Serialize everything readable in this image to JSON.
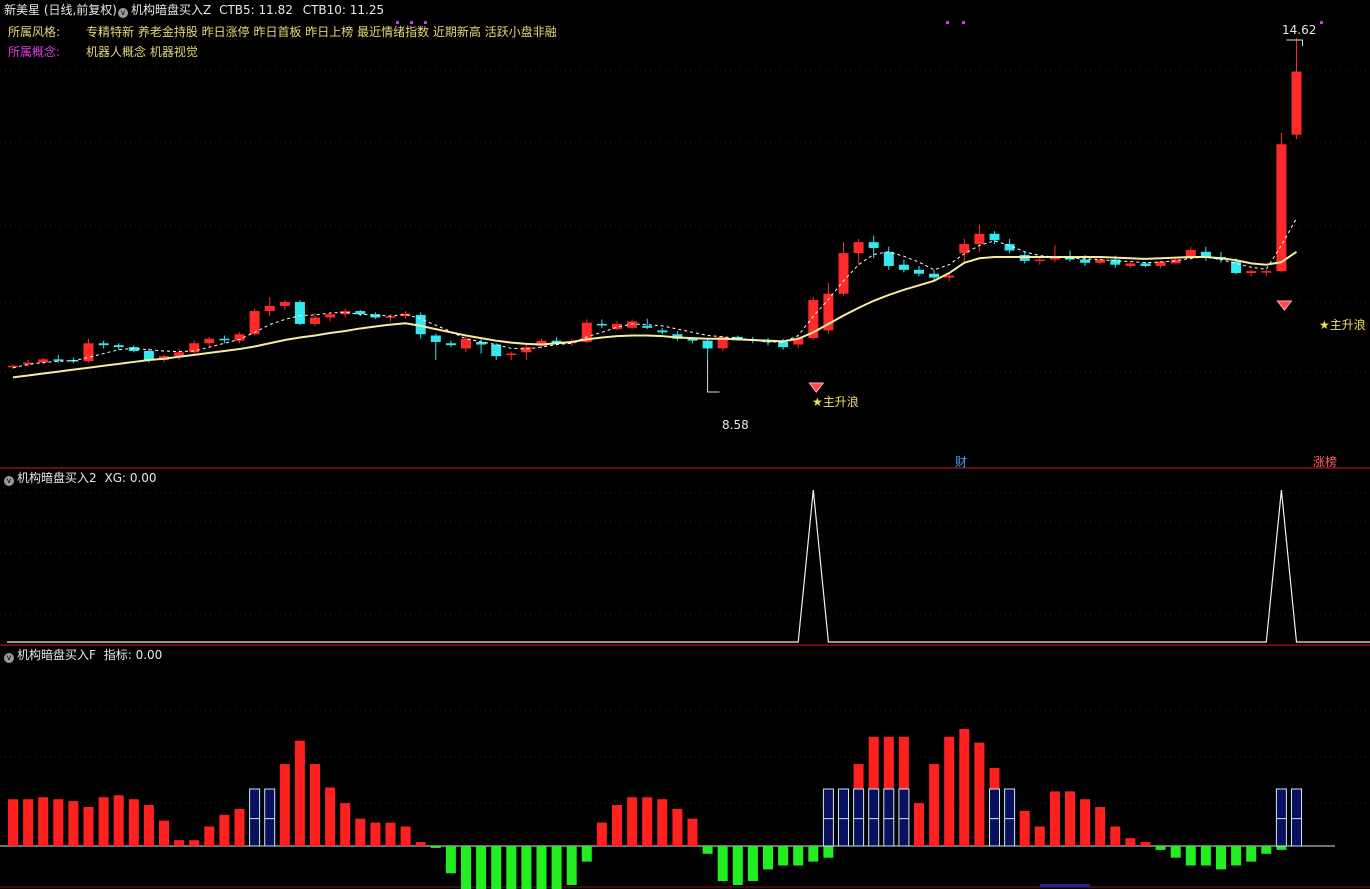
{
  "header": {
    "stock_title": "新美星 (日线,前复权)",
    "indicator_name": "机构暗盘买入Z",
    "ctb5": "CTB5: 11.82",
    "ctb10": "CTB10: 11.25",
    "style_label": "所属风格:",
    "style_tags": "专精特新 养老金持股 昨日涨停 昨日首板 昨日上榜 最近情绪指数 近期新高 活跃小盘非融",
    "concept_label": "所属概念:",
    "concept_tags": "机器人概念 机器视觉"
  },
  "main_chart": {
    "high_label": "14.62",
    "low_label": "8.58",
    "signal_labels": [
      "★主升浪",
      "★主升浪"
    ],
    "event_badges": [
      "财",
      "涨榜"
    ]
  },
  "panel2": {
    "title": "机构暗盘买入2",
    "value": "XG: 0.00"
  },
  "panel3": {
    "title": "机构暗盘买入F",
    "value": "指标: 0.00"
  },
  "colors": {
    "up": "#ff2a2a",
    "down": "#35e8ef",
    "ma_fast": "#ffffff",
    "ma_slow": "#f5eca0",
    "hist_up": "#ff2020",
    "hist_down": "#22ee22",
    "divider": "#8b1010"
  },
  "chart_data": [
    {
      "type": "candlestick",
      "title": "新美星 (日线,前复权)",
      "ohlc": [
        [
          9.52,
          9.55,
          9.48,
          9.53
        ],
        [
          9.55,
          9.62,
          9.52,
          9.58
        ],
        [
          9.58,
          9.65,
          9.55,
          9.63
        ],
        [
          9.63,
          9.7,
          9.58,
          9.61
        ],
        [
          9.62,
          9.66,
          9.57,
          9.6
        ],
        [
          9.6,
          9.95,
          9.58,
          9.88
        ],
        [
          9.88,
          9.92,
          9.8,
          9.85
        ],
        [
          9.85,
          9.88,
          9.78,
          9.82
        ],
        [
          9.82,
          9.85,
          9.74,
          9.76
        ],
        [
          9.76,
          9.8,
          9.58,
          9.62
        ],
        [
          9.62,
          9.7,
          9.58,
          9.68
        ],
        [
          9.68,
          9.8,
          9.62,
          9.74
        ],
        [
          9.74,
          9.92,
          9.7,
          9.88
        ],
        [
          9.88,
          9.98,
          9.83,
          9.95
        ],
        [
          9.95,
          10.0,
          9.88,
          9.93
        ],
        [
          9.92,
          10.05,
          9.88,
          10.02
        ],
        [
          10.02,
          10.42,
          10.0,
          10.38
        ],
        [
          10.38,
          10.6,
          10.3,
          10.46
        ],
        [
          10.46,
          10.55,
          10.4,
          10.52
        ],
        [
          10.52,
          10.55,
          10.16,
          10.18
        ],
        [
          10.18,
          10.35,
          10.15,
          10.28
        ],
        [
          10.28,
          10.36,
          10.22,
          10.33
        ],
        [
          10.33,
          10.42,
          10.28,
          10.38
        ],
        [
          10.38,
          10.4,
          10.3,
          10.33
        ],
        [
          10.33,
          10.36,
          10.26,
          10.28
        ],
        [
          10.28,
          10.33,
          10.22,
          10.3
        ],
        [
          10.3,
          10.38,
          10.26,
          10.34
        ],
        [
          10.32,
          10.36,
          9.95,
          10.02
        ],
        [
          10.0,
          10.03,
          9.62,
          9.9
        ],
        [
          9.88,
          9.92,
          9.82,
          9.85
        ],
        [
          9.8,
          9.98,
          9.74,
          9.95
        ],
        [
          9.9,
          9.95,
          9.72,
          9.86
        ],
        [
          9.86,
          9.88,
          9.62,
          9.68
        ],
        [
          9.7,
          9.75,
          9.62,
          9.72
        ],
        [
          9.74,
          9.86,
          9.62,
          9.82
        ],
        [
          9.84,
          9.95,
          9.8,
          9.92
        ],
        [
          9.92,
          9.98,
          9.85,
          9.88
        ],
        [
          9.88,
          9.95,
          9.84,
          9.91
        ],
        [
          9.9,
          10.25,
          9.88,
          10.2
        ],
        [
          10.18,
          10.25,
          10.12,
          10.16
        ],
        [
          10.1,
          10.22,
          10.08,
          10.18
        ],
        [
          10.12,
          10.25,
          10.1,
          10.22
        ],
        [
          10.15,
          10.26,
          10.1,
          10.12
        ],
        [
          10.08,
          10.12,
          10.02,
          10.05
        ],
        [
          10.02,
          10.07,
          9.92,
          9.95
        ],
        [
          9.95,
          9.98,
          9.88,
          9.92
        ],
        [
          9.92,
          9.96,
          9.62,
          9.8
        ],
        [
          9.8,
          10.0,
          9.76,
          9.98
        ],
        [
          9.98,
          10.0,
          9.92,
          9.95
        ],
        [
          9.94,
          9.98,
          9.88,
          9.93
        ],
        [
          9.92,
          9.96,
          9.85,
          9.9
        ],
        [
          9.9,
          9.95,
          9.78,
          9.82
        ],
        [
          9.86,
          10.0,
          9.8,
          9.96
        ],
        [
          9.96,
          10.6,
          9.93,
          10.55
        ],
        [
          10.08,
          10.82,
          10.02,
          10.65
        ],
        [
          10.65,
          11.45,
          10.62,
          11.28
        ],
        [
          11.28,
          11.5,
          11.1,
          11.45
        ],
        [
          11.45,
          11.55,
          11.2,
          11.36
        ],
        [
          11.3,
          11.38,
          11.02,
          11.08
        ],
        [
          11.1,
          11.18,
          10.98,
          11.02
        ],
        [
          11.02,
          11.08,
          10.92,
          10.96
        ],
        [
          10.96,
          11.02,
          10.85,
          10.9
        ],
        [
          10.9,
          10.96,
          10.84,
          10.93
        ],
        [
          11.28,
          11.5,
          11.12,
          11.42
        ],
        [
          11.42,
          11.72,
          11.3,
          11.58
        ],
        [
          11.58,
          11.62,
          11.42,
          11.48
        ],
        [
          11.42,
          11.5,
          11.28,
          11.32
        ],
        [
          11.25,
          11.3,
          11.12,
          11.16
        ],
        [
          11.16,
          11.22,
          11.1,
          11.18
        ],
        [
          11.18,
          11.4,
          11.14,
          11.22
        ],
        [
          11.22,
          11.32,
          11.15,
          11.18
        ],
        [
          11.18,
          11.25,
          11.08,
          11.13
        ],
        [
          11.13,
          11.22,
          11.1,
          11.18
        ],
        [
          11.18,
          11.24,
          11.05,
          11.1
        ],
        [
          11.08,
          11.14,
          11.05,
          11.12
        ],
        [
          11.12,
          11.14,
          11.06,
          11.08
        ],
        [
          11.08,
          11.16,
          11.04,
          11.15
        ],
        [
          11.12,
          11.2,
          11.12,
          11.18
        ],
        [
          11.2,
          11.38,
          11.17,
          11.33
        ],
        [
          11.3,
          11.38,
          11.16,
          11.21
        ],
        [
          11.22,
          11.3,
          11.13,
          11.18
        ],
        [
          11.15,
          11.2,
          10.95,
          10.97
        ],
        [
          10.97,
          11.02,
          10.92,
          11.0
        ],
        [
          11.0,
          11.02,
          10.93,
          11.0
        ],
        [
          11.0,
          13.15,
          10.98,
          12.97
        ],
        [
          13.12,
          14.62,
          13.05,
          14.1
        ]
      ],
      "ma_slow": [
        9.35,
        9.38,
        9.41,
        9.44,
        9.47,
        9.5,
        9.53,
        9.56,
        9.59,
        9.62,
        9.64,
        9.67,
        9.7,
        9.73,
        9.76,
        9.79,
        9.83,
        9.88,
        9.93,
        9.97,
        10.0,
        10.04,
        10.07,
        10.11,
        10.14,
        10.17,
        10.19,
        10.15,
        10.1,
        10.05,
        10.0,
        9.96,
        9.92,
        9.89,
        9.87,
        9.86,
        9.88,
        9.9,
        9.94,
        9.97,
        9.99,
        10.0,
        10.0,
        9.99,
        9.97,
        9.96,
        9.95,
        9.95,
        9.94,
        9.93,
        9.92,
        9.91,
        9.95,
        10.05,
        10.18,
        10.31,
        10.43,
        10.54,
        10.63,
        10.71,
        10.78,
        10.85,
        10.97,
        11.13,
        11.2,
        11.22,
        11.22,
        11.22,
        11.22,
        11.22,
        11.22,
        11.22,
        11.22,
        11.21,
        11.2,
        11.19,
        11.2,
        11.21,
        11.22,
        11.22,
        11.2,
        11.17,
        11.12,
        11.1,
        11.14,
        11.3
      ],
      "ma_fast": [
        9.5,
        9.55,
        9.58,
        9.6,
        9.61,
        9.66,
        9.72,
        9.78,
        9.8,
        9.78,
        9.76,
        9.75,
        9.76,
        9.82,
        9.88,
        9.94,
        10.05,
        10.17,
        10.25,
        10.31,
        10.32,
        10.35,
        10.36,
        10.33,
        10.32,
        10.3,
        10.33,
        10.26,
        10.16,
        10.06,
        9.95,
        9.9,
        9.86,
        9.8,
        9.79,
        9.82,
        9.86,
        9.88,
        9.98,
        10.05,
        10.13,
        10.18,
        10.17,
        10.15,
        10.1,
        10.05,
        10.0,
        9.98,
        9.96,
        9.93,
        9.9,
        9.9,
        10.0,
        10.3,
        10.56,
        10.85,
        11.1,
        11.26,
        11.3,
        11.23,
        11.14,
        11.02,
        11.1,
        11.27,
        11.4,
        11.47,
        11.4,
        11.3,
        11.24,
        11.22,
        11.2,
        11.19,
        11.18,
        11.16,
        11.15,
        11.13,
        11.14,
        11.16,
        11.2,
        11.22,
        11.18,
        11.12,
        11.06,
        11.03,
        11.4,
        11.82
      ],
      "ylim": [
        8.3,
        14.9
      ],
      "annotations": [
        "14.62",
        "8.58",
        "★主升浪",
        "★主升浪"
      ]
    },
    {
      "type": "line",
      "name": "XG",
      "values": [
        0,
        0,
        0,
        0,
        0,
        0,
        0,
        0,
        0,
        0,
        0,
        0,
        0,
        0,
        0,
        0,
        0,
        0,
        0,
        0,
        0,
        0,
        0,
        0,
        0,
        0,
        0,
        0,
        0,
        0,
        0,
        0,
        0,
        0,
        0,
        0,
        0,
        0,
        0,
        0,
        0,
        0,
        0,
        0,
        0,
        0,
        0,
        0,
        0,
        0,
        0,
        0,
        0,
        1,
        0,
        0,
        0,
        0,
        0,
        0,
        0,
        0,
        0,
        0,
        0,
        0,
        0,
        0,
        0,
        0,
        0,
        0,
        0,
        0,
        0,
        0,
        0,
        0,
        0,
        0,
        0,
        0,
        0,
        0,
        1,
        0
      ],
      "ylim": [
        0,
        1
      ]
    },
    {
      "type": "bar",
      "name": "指标",
      "values": [
        24,
        24,
        25,
        24,
        23,
        20,
        25,
        26,
        24,
        21,
        13,
        3,
        3,
        10,
        16,
        19,
        21,
        26,
        42,
        54,
        42,
        30,
        22,
        14,
        12,
        12,
        10,
        2,
        -1,
        -14,
        -34,
        -38,
        -32,
        -34,
        -38,
        -40,
        -32,
        -20,
        -8,
        12,
        21,
        25,
        25,
        24,
        19,
        14,
        -4,
        -18,
        -20,
        -18,
        -12,
        -10,
        -10,
        -8,
        -6,
        28,
        42,
        56,
        56,
        56,
        22,
        42,
        56,
        60,
        53,
        40,
        27,
        18,
        10,
        28,
        28,
        24,
        20,
        10,
        4,
        2,
        -2,
        -6,
        -10,
        -10,
        -12,
        -10,
        -8,
        -4,
        -2,
        2
      ],
      "outline_overlay": [
        0,
        0,
        0,
        0,
        0,
        0,
        0,
        0,
        0,
        0,
        0,
        0,
        0,
        0,
        0,
        0,
        30,
        30,
        0,
        0,
        0,
        0,
        0,
        0,
        0,
        0,
        0,
        0,
        0,
        0,
        0,
        0,
        0,
        0,
        0,
        0,
        0,
        0,
        0,
        0,
        0,
        0,
        0,
        0,
        0,
        0,
        0,
        0,
        0,
        0,
        0,
        0,
        0,
        0,
        30,
        30,
        30,
        30,
        30,
        30,
        0,
        0,
        0,
        0,
        0,
        30,
        30,
        0,
        0,
        0,
        0,
        0,
        0,
        0,
        0,
        0,
        0,
        0,
        0,
        0,
        0,
        0,
        0,
        0,
        30,
        30
      ]
    }
  ]
}
